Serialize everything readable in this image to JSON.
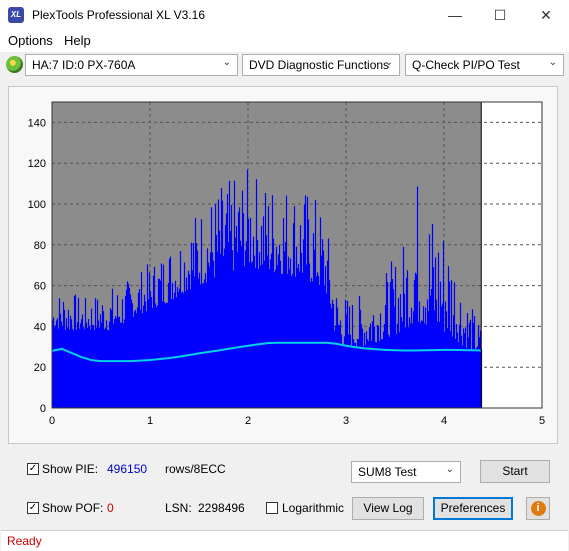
{
  "app": {
    "title": "PlexTools Professional XL V3.16",
    "icon_text": "XL"
  },
  "window_controls": {
    "minimize": "—",
    "maximize": "☐",
    "close": "✕"
  },
  "menu": {
    "options": "Options",
    "help": "Help"
  },
  "toolbar": {
    "drive": "HA:7 ID:0  PX-760A",
    "function": "DVD Diagnostic Functions",
    "test": "Q-Check PI/PO Test"
  },
  "chart_data": {
    "type": "area",
    "xlim": [
      0,
      5
    ],
    "ylim": [
      0,
      150
    ],
    "x_ticks": [
      "0",
      "1",
      "2",
      "3",
      "4",
      "5"
    ],
    "y_ticks": [
      "0",
      "20",
      "40",
      "60",
      "80",
      "100",
      "120",
      "140"
    ],
    "data_end_x": 4.38,
    "grid": true,
    "series": [
      {
        "color": "#0000ff",
        "x": [
          0,
          0.1,
          0.2,
          0.3,
          0.4,
          0.5,
          0.6,
          0.7,
          0.8,
          0.9,
          1.0,
          1.1,
          1.2,
          1.3,
          1.4,
          1.5,
          1.6,
          1.7,
          1.8,
          1.9,
          2.0,
          2.1,
          2.2,
          2.3,
          2.4,
          2.5,
          2.6,
          2.7,
          2.8,
          2.9,
          3.0,
          3.1,
          3.2,
          3.3,
          3.4,
          3.5,
          3.6,
          3.7,
          3.8,
          3.9,
          4.0,
          4.1,
          4.2,
          4.3,
          4.38
        ],
        "peak": [
          52,
          60,
          58,
          54,
          55,
          58,
          60,
          62,
          64,
          68,
          72,
          76,
          82,
          88,
          95,
          100,
          104,
          110,
          112,
          115,
          118,
          115,
          112,
          114,
          112,
          110,
          108,
          104,
          90,
          62,
          56,
          55,
          58,
          62,
          68,
          75,
          85,
          118,
          110,
          100,
          95,
          80,
          60,
          48,
          40
        ],
        "base": [
          40,
          38,
          38,
          38,
          38,
          38,
          38,
          40,
          44,
          46,
          48,
          50,
          52,
          55,
          58,
          60,
          62,
          64,
          66,
          68,
          70,
          68,
          66,
          66,
          65,
          64,
          62,
          60,
          55,
          32,
          30,
          30,
          30,
          32,
          34,
          36,
          38,
          42,
          40,
          38,
          36,
          34,
          30,
          28,
          26
        ]
      },
      {
        "color": "#00d0e8",
        "x": [
          0,
          0.1,
          0.2,
          0.3,
          0.4,
          0.5,
          0.6,
          0.7,
          0.8,
          0.9,
          1.0,
          1.1,
          1.2,
          1.3,
          1.4,
          1.5,
          1.6,
          1.7,
          1.8,
          1.9,
          2.0,
          2.1,
          2.2,
          2.3,
          2.4,
          2.5,
          2.6,
          2.7,
          2.8,
          2.9,
          3.0,
          3.1,
          3.2,
          3.3,
          3.4,
          3.5,
          3.6,
          3.7,
          3.8,
          3.9,
          4.0,
          4.1,
          4.2,
          4.3,
          4.38
        ],
        "values": [
          28,
          29,
          27,
          25,
          23.5,
          23,
          23,
          23,
          23,
          23.2,
          23.5,
          24,
          24.5,
          25.2,
          26,
          26.8,
          27.5,
          28.2,
          29,
          29.8,
          30.5,
          31.2,
          31.8,
          32,
          32,
          32,
          32,
          32,
          32,
          31.5,
          30.5,
          29.8,
          29.2,
          28.8,
          28.5,
          28.3,
          28.2,
          28.2,
          28.3,
          28.4,
          28.5,
          28.5,
          28.4,
          28.3,
          28.2
        ]
      }
    ]
  },
  "controls": {
    "show_pie_label": "Show PIE:",
    "pie_value": "496150",
    "rows_label": "rows/8ECC",
    "test_select": "SUM8 Test",
    "start_label": "Start",
    "show_pof_label": "Show POF:",
    "pof_value": "0",
    "lsn_label": "LSN:",
    "lsn_value": "2298496",
    "log_label": "Logarithmic",
    "viewlog_label": "View Log",
    "preferences_label": "Preferences",
    "info_icon": "i",
    "checkmark": "✓",
    "dropdown_arrow": "⌄"
  },
  "status": {
    "text": "Ready"
  },
  "colors": {
    "pie_value": "#0000cc",
    "pof_value": "#cc0000",
    "status_text": "#cc0000",
    "info": "#e07a10"
  }
}
